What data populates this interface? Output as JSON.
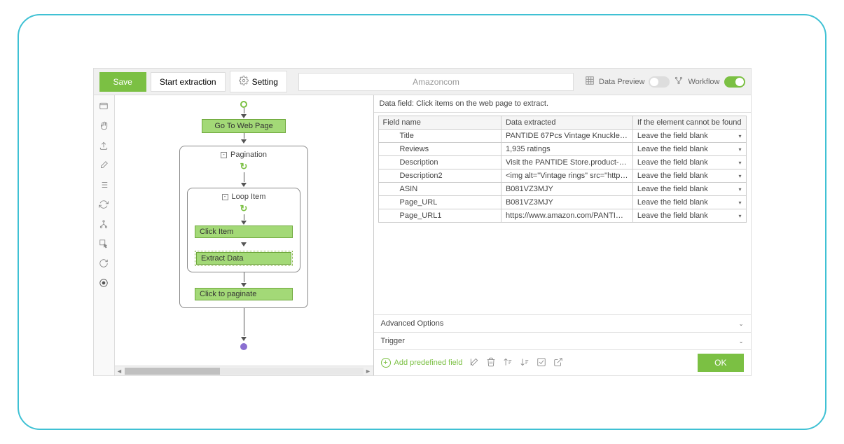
{
  "toolbar": {
    "save": "Save",
    "start_extraction": "Start extraction",
    "setting": "Setting",
    "url_display": "Amazoncom",
    "data_preview": "Data Preview",
    "workflow": "Workflow"
  },
  "workflow_nodes": {
    "go_to_web_page": "Go To Web Page",
    "pagination": "Pagination",
    "loop_item": "Loop Item",
    "click_item": "Click Item",
    "extract_data": "Extract Data",
    "click_to_paginate": "Click to paginate"
  },
  "right_panel": {
    "header": "Data field: Click items on the web page to extract.",
    "col_field_name": "Field name",
    "col_data_extracted": "Data extracted",
    "col_not_found": "If the element cannot be found",
    "rows": [
      {
        "field": "Title",
        "data": "PANTIDE 67Pcs Vintage Knuckle ...",
        "fallback": "Leave the field blank"
      },
      {
        "field": "Reviews",
        "data": "1,935 ratings",
        "fallback": "Leave the field blank"
      },
      {
        "field": "Description",
        "data": "Visit the PANTIDE Store.product-titl...",
        "fallback": "Leave the field blank"
      },
      {
        "field": "Description2",
        "data": "<img alt=\"Vintage rings\" src=\"https...",
        "fallback": "Leave the field blank"
      },
      {
        "field": "ASIN",
        "data": "B081VZ3MJY",
        "fallback": "Leave the field blank"
      },
      {
        "field": "Page_URL",
        "data": "B081VZ3MJY",
        "fallback": "Leave the field blank"
      },
      {
        "field": "Page_URL1",
        "data": "https://www.amazon.com/PANTIDE...",
        "fallback": "Leave the field blank"
      }
    ],
    "advanced_options": "Advanced Options",
    "trigger": "Trigger",
    "add_predefined": "Add predefined field",
    "ok": "OK"
  }
}
